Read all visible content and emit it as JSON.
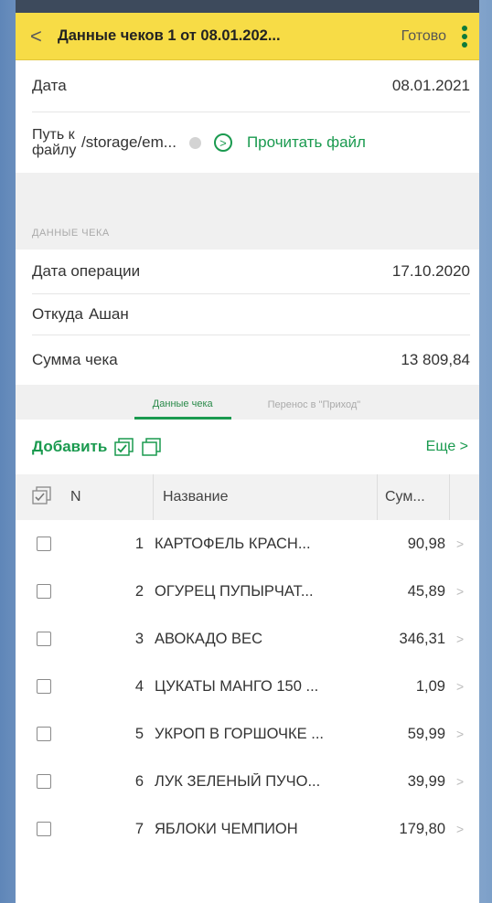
{
  "header": {
    "back_icon": "chevron-left-icon",
    "title": "Данные чеков 1 от 08.01.202...",
    "done_label": "Готово",
    "more_icon": "kebab-menu-icon"
  },
  "form": {
    "date_label": "Дата",
    "date_value": "08.01.2021",
    "path_label": "Путь к файлу",
    "path_value": "/storage/em...",
    "read_file_label": "Прочитать файл"
  },
  "receipt": {
    "section_title": "ДАННЫЕ ЧЕКА",
    "op_date_label": "Дата операции",
    "op_date_value": "17.10.2020",
    "from_label": "Откуда",
    "from_value": "Ашан",
    "sum_label": "Сумма чека",
    "sum_value": "13 809,84"
  },
  "tabs": {
    "active": "Данные чека",
    "inactive": "Перенос в \"Приход\""
  },
  "toolbar": {
    "add_label": "Добавить",
    "more_label": "Еще >"
  },
  "table": {
    "headers": {
      "n": "N",
      "name": "Название",
      "sum": "Сум..."
    },
    "rows": [
      {
        "n": "1",
        "name": "КАРТОФЕЛЬ КРАСН...",
        "sum": "90,98"
      },
      {
        "n": "2",
        "name": "ОГУРЕЦ ПУПЫРЧАТ...",
        "sum": "45,89"
      },
      {
        "n": "3",
        "name": "АВОКАДО ВЕС",
        "sum": "346,31"
      },
      {
        "n": "4",
        "name": "ЦУКАТЫ МАНГО 150 ...",
        "sum": "1,09"
      },
      {
        "n": "5",
        "name": "УКРОП В ГОРШОЧКЕ ...",
        "sum": "59,99"
      },
      {
        "n": "6",
        "name": "ЛУК ЗЕЛЕНЫЙ ПУЧО...",
        "sum": "39,99"
      },
      {
        "n": "7",
        "name": "ЯБЛОКИ ЧЕМПИОН",
        "sum": "179,80"
      }
    ]
  },
  "colors": {
    "accent": "#1a9a4f",
    "header_bg": "#f7dc46"
  }
}
